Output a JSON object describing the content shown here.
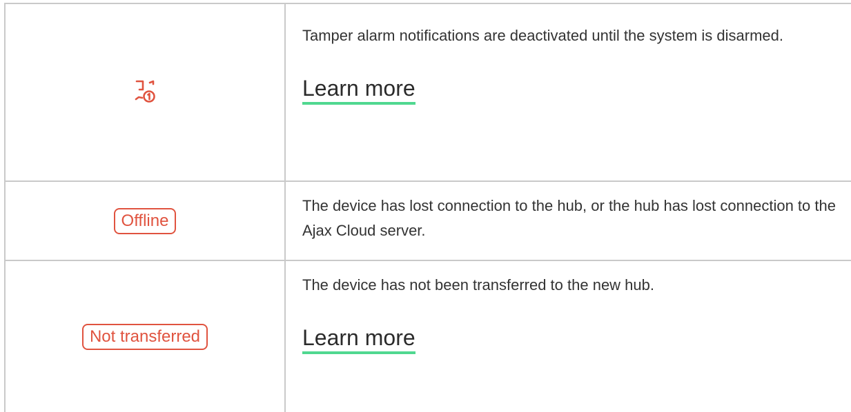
{
  "colors": {
    "status_red": "#e0533f",
    "link_underline": "#50d890",
    "text": "#333333",
    "grid": "#c9c9c9"
  },
  "rows": [
    {
      "status_icon": "tamper-alarm-muted-icon",
      "description": "Tamper alarm notifications are deactivated until the system is disarmed.",
      "link": "Learn more"
    },
    {
      "status_label": "Offline",
      "description": "The device has lost connection to the hub, or the hub has lost connection to the Ajax Cloud server."
    },
    {
      "status_label": "Not transferred",
      "description": "The device has not been transferred to the new hub.",
      "link": "Learn more"
    }
  ]
}
